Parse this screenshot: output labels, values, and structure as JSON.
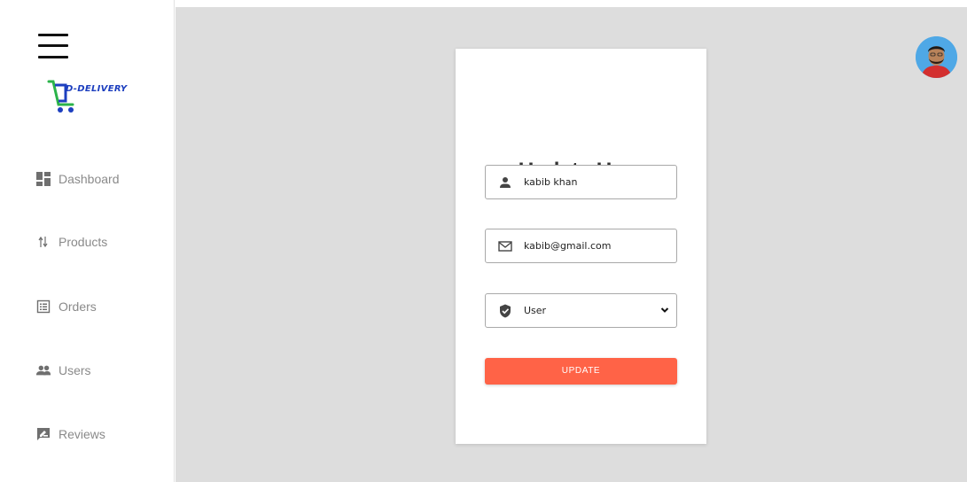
{
  "sidebar": {
    "logo_text": "D-DELIVERY",
    "items": [
      {
        "label": "Dashboard",
        "icon": "dashboard-icon"
      },
      {
        "label": "Products",
        "icon": "sort-arrows-icon"
      },
      {
        "label": "Orders",
        "icon": "list-alt-icon"
      },
      {
        "label": "Users",
        "icon": "people-icon"
      },
      {
        "label": "Reviews",
        "icon": "rate-review-icon"
      }
    ]
  },
  "form": {
    "title": "Update User",
    "name_value": "kabib khan",
    "email_value": "kabib@gmail.com",
    "role_value": "User",
    "submit_label": "UPDATE"
  },
  "colors": {
    "accent": "#ff6347",
    "main_bg": "#dddddd",
    "logo_blue": "#1d3fbf",
    "logo_green": "#2bb34a"
  }
}
